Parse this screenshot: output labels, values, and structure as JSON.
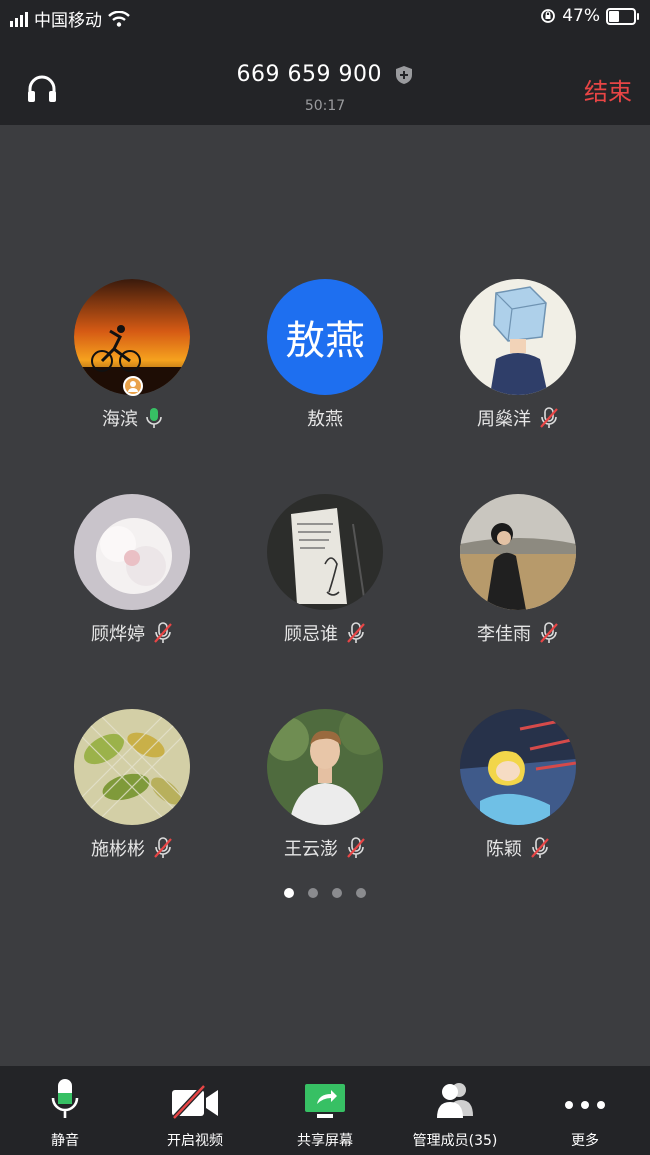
{
  "status_bar": {
    "carrier": "中国移动",
    "battery": "47%",
    "battery_level": 0.47
  },
  "header": {
    "meeting_id": "669 659 900",
    "duration": "50:17",
    "end_label": "结束"
  },
  "participants": [
    {
      "name": "海滨",
      "avatar": "sunset-cyclist-photo",
      "mic": "on",
      "host": true
    },
    {
      "name": "敖燕",
      "avatar_text": "敖燕",
      "mic": "none"
    },
    {
      "name": "周燊洋",
      "avatar": "ice-cube-head-drawing",
      "mic": "muted"
    },
    {
      "name": "顾烨婷",
      "avatar": "white-flower-photo",
      "mic": "muted"
    },
    {
      "name": "顾忌谁",
      "avatar": "notebook-sketch-photo",
      "mic": "muted"
    },
    {
      "name": "李佳雨",
      "avatar": "girl-in-field-photo",
      "mic": "muted"
    },
    {
      "name": "施彬彬",
      "avatar": "leaves-fence-photo",
      "mic": "muted"
    },
    {
      "name": "王云澎",
      "avatar": "young-man-photo",
      "mic": "muted"
    },
    {
      "name": "陈颖",
      "avatar": "cartoon-girl-illustration",
      "mic": "muted"
    }
  ],
  "pager": {
    "pages": 4,
    "current": 1
  },
  "toolbar": {
    "mute": "静音",
    "video": "开启视频",
    "share": "共享屏幕",
    "members": "管理成员(35)",
    "more": "更多"
  },
  "colors": {
    "accent_blue": "#1e6ff0",
    "end_red": "#e84545",
    "mic_green": "#37c064",
    "muted_red": "#e84545"
  }
}
